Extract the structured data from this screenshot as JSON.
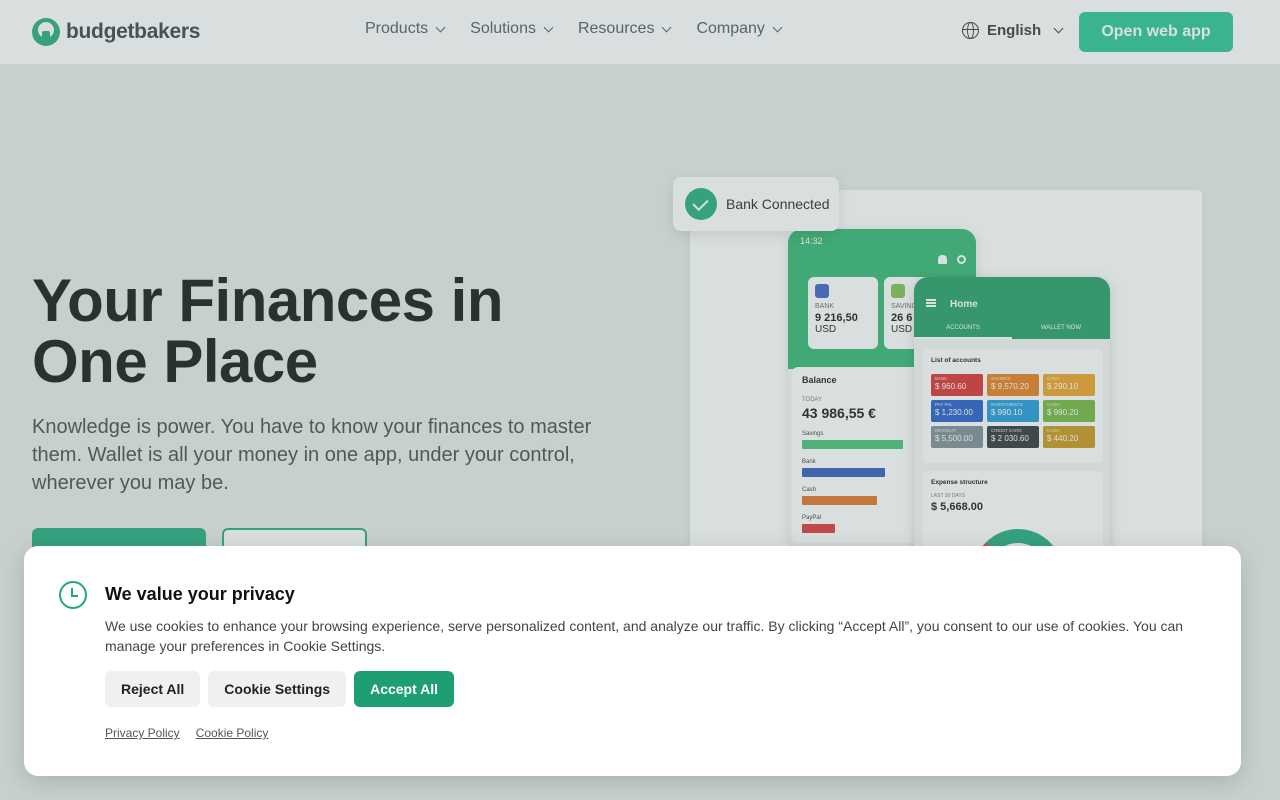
{
  "header": {
    "logo_text": "budgetbakers",
    "nav": [
      {
        "label": "Products"
      },
      {
        "label": "Solutions"
      },
      {
        "label": "Resources"
      },
      {
        "label": "Company"
      }
    ],
    "language": "English",
    "open_app_label": "Open web app"
  },
  "hero": {
    "title_line1": "Your Finances in",
    "title_line2": "One Place",
    "description": "Knowledge is power. You have to know your finances to master them. Wallet is all your money in one app, under your control, wherever you may be."
  },
  "illustration": {
    "toast": "Bank Connected",
    "phone1": {
      "time": "14:32",
      "cards": [
        {
          "label": "BANK",
          "value": "9 216,50",
          "currency": "USD",
          "color": "#3b5fc0"
        },
        {
          "label": "SAVING",
          "value": "26 6",
          "currency": "USD",
          "color": "#7cc04b"
        }
      ],
      "balance_title": "Balance",
      "balance_period": "TODAY",
      "balance_value": "43 986,55 €",
      "bars": [
        {
          "label": "Savings",
          "fraction": 0.92,
          "color": "#3fbf72"
        },
        {
          "label": "Bank",
          "fraction": 0.75,
          "color": "#2f55b8"
        },
        {
          "label": "Cash",
          "fraction": 0.68,
          "color": "#e0701f"
        },
        {
          "label": "PayPal",
          "fraction": 0.3,
          "color": "#d93030"
        }
      ]
    },
    "phone2": {
      "title": "Home",
      "tabs": [
        "ACCOUNTS",
        "WALLET NOW"
      ],
      "list_title": "List of accounts",
      "accounts": [
        {
          "label": "BANK",
          "value": "$ 960.60",
          "color": "#d92b2b"
        },
        {
          "label": "SAVINGS",
          "value": "$ 9,570.20",
          "color": "#e67a17"
        },
        {
          "label": "CASH",
          "value": "$ 290.10",
          "color": "#eea021"
        },
        {
          "label": "PAY PAL",
          "value": "$ 1,230.00",
          "color": "#1f58c9"
        },
        {
          "label": "INVESTMENTS",
          "value": "$ 990.10",
          "color": "#1a96d9"
        },
        {
          "label": "CASH",
          "value": "$ 990.20",
          "color": "#6fb539"
        },
        {
          "label": "REVOLUT",
          "value": "$ 5,500.00",
          "color": "#7a8b94"
        },
        {
          "label": "CREDIT CARD",
          "value": "$ 2 030.60",
          "color": "#2a2f33"
        },
        {
          "label": "CASH",
          "value": "$ 440.20",
          "color": "#c99414"
        }
      ],
      "expense_title": "Expense structure",
      "expense_period": "LAST 30 DAYS",
      "expense_value": "$ 5,668.00"
    }
  },
  "cookie": {
    "title": "We value your privacy",
    "text": "We use cookies to enhance your browsing experience, serve personalized content, and analyze our traffic. By clicking “Accept All”, you consent to our use of cookies. You can manage your preferences in Cookie Settings.",
    "reject_label": "Reject All",
    "settings_label": "Cookie Settings",
    "accept_label": "Accept All",
    "privacy_link": "Privacy Policy",
    "cookie_link": "Cookie Policy"
  },
  "colors": {
    "brand": "#1ea97c",
    "open_app_bg": "#22c394",
    "accept_bg": "#1e9e74"
  }
}
